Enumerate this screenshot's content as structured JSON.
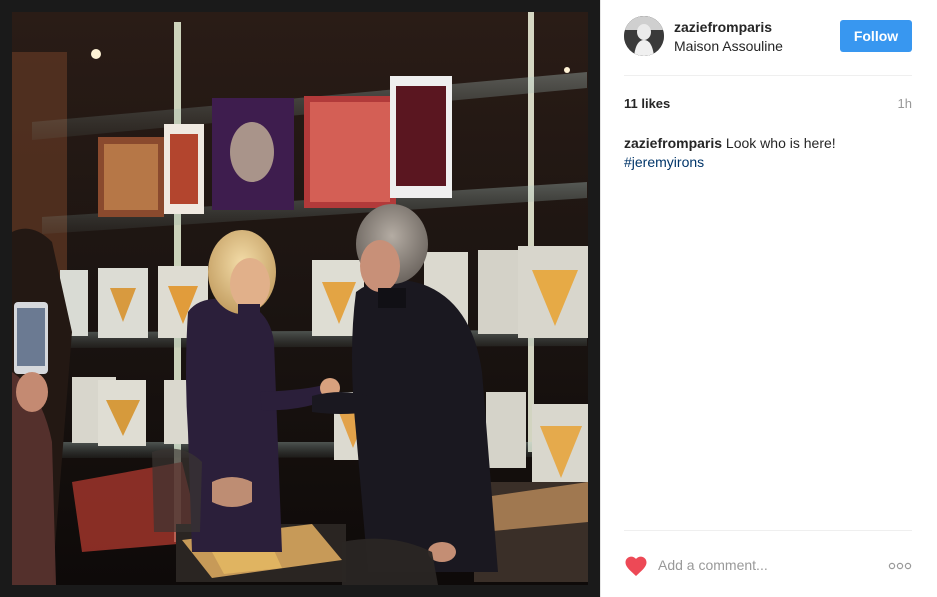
{
  "post": {
    "username": "zaziefromparis",
    "location": "Maison Assouline",
    "follow_label": "Follow",
    "likes": "11 likes",
    "time": "1h",
    "caption_user": "zaziefromparis",
    "caption_text": " Look who is here!",
    "hashtag": "#jeremyirons",
    "comment_placeholder": "Add a comment..."
  },
  "icons": {
    "like": "heart-icon",
    "more": "more-options-icon"
  },
  "colors": {
    "follow_button": "#3897f0",
    "like_heart": "#ed4956",
    "hashtag": "#003569"
  }
}
